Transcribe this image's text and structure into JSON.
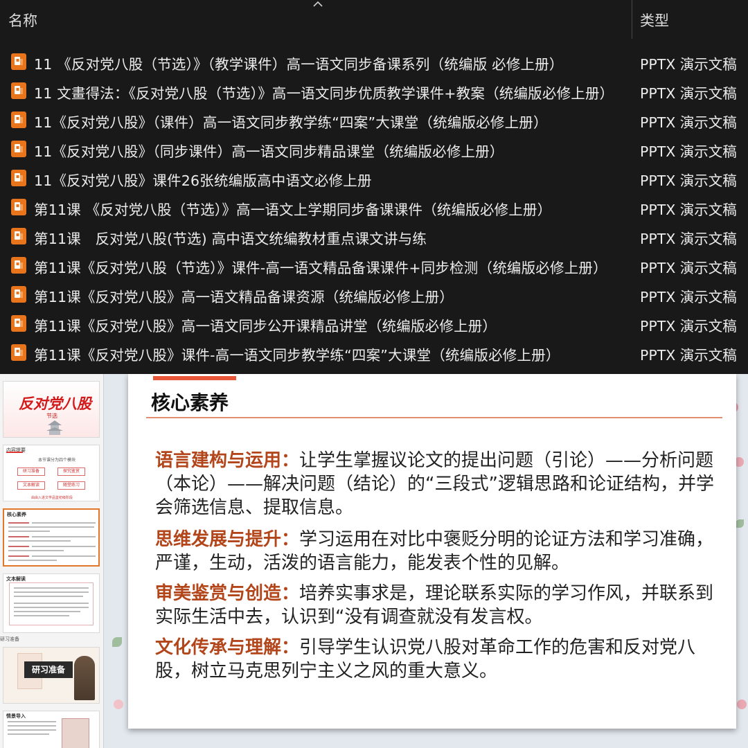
{
  "explorer": {
    "columns": {
      "name": "名称",
      "type": "类型"
    },
    "files": [
      {
        "name": "11 《反对党八股（节选）》（教学课件）高一语文同步备课系列（统编版 必修上册）",
        "type": "PPTX 演示文稿"
      },
      {
        "name": "11 文畫得法：《反对党八股（节选）》高一语文同步优质教学课件+教案（统编版必修上册）",
        "type": "PPTX 演示文稿"
      },
      {
        "name": "11《反对党八股》（课件）高一语文同步教学练“四案”大课堂（统编版必修上册）",
        "type": "PPTX 演示文稿"
      },
      {
        "name": "11《反对党八股》（同步课件）高一语文同步精品课堂（统编版必修上册）",
        "type": "PPTX 演示文稿"
      },
      {
        "name": "11《反对党八股》课件26张统编版高中语文必修上册",
        "type": "PPTX 演示文稿"
      },
      {
        "name": "第11课 《反对党八股（节选）》高一语文上学期同步备课课件（统编版必修上册）",
        "type": "PPTX 演示文稿"
      },
      {
        "name": "第11课　反对党八股(节选) 高中语文统编教材重点课文讲与练",
        "type": "PPTX 演示文稿"
      },
      {
        "name": "第11课《反对党八股（节选）》课件-高一语文精品备课课件+同步检测（统编版必修上册）",
        "type": "PPTX 演示文稿"
      },
      {
        "name": "第11课《反对党八股》高一语文精品备课资源（统编版必修上册）",
        "type": "PPTX 演示文稿"
      },
      {
        "name": "第11课《反对党八股》高一语文同步公开课精品讲堂（统编版必修上册）",
        "type": "PPTX 演示文稿"
      },
      {
        "name": "第11课《反对党八股》课件-高一语文同步教学练“四案”大课堂（统编版必修上册）",
        "type": "PPTX 演示文稿"
      }
    ]
  },
  "thumbnails": {
    "cover_title": "反对党八股",
    "cover_subtitle": "节选",
    "toc_head": "内容提要",
    "toc_note": "本节课分为四个模块",
    "toc_items": [
      "研习准备",
      "探究鉴赏",
      "文本解读",
      "随堂练习"
    ],
    "toc_foot": "由由入进文学品鉴初级阶段",
    "core_head": "核心素养",
    "text_head": "文本解读",
    "section_label": "研习准备",
    "prep_label": "研习准备",
    "intro_head": "情景导入"
  },
  "slide": {
    "title": "核心素养",
    "paragraphs": [
      {
        "keyword": "语言建构与运用：",
        "text": "让学生掌握议论文的提出问题（引论）——分析问题（本论）——解决问题（结论）的“三段式”逻辑思路和论证结构，并学会筛选信息、提取信息。"
      },
      {
        "keyword": "思维发展与提升：",
        "text": "学习运用在对比中褒贬分明的论证方法和学习准确，严谨，生动，活泼的语言能力，能发表个性的见解。"
      },
      {
        "keyword": "审美鉴赏与创造：",
        "text": "培养实事求是，理论联系实际的学习作风，并联系到实际生活中去，认识到“没有调查就没有发言权。"
      },
      {
        "keyword": "文化传承与理解：",
        "text": "引导学生认识党八股对革命工作的危害和反对党八股，树立马克思列宁主义之风的重大意义。"
      }
    ]
  },
  "colors": {
    "keyword": "#b3451a",
    "accent": "#e8573a",
    "explorer_bg": "#191919",
    "icon": "#e8741c"
  }
}
